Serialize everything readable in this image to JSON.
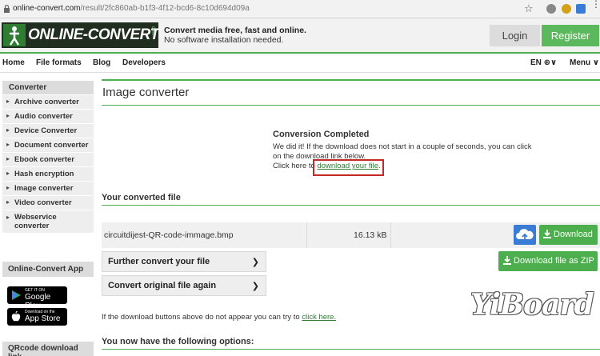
{
  "browser": {
    "url_domain": "online-convert.com",
    "url_path": "/result/2fc860ab-b1f3-4f12-bcd6-8c10d694d09a"
  },
  "header": {
    "logo_text_main": "ONLINE-",
    "logo_text_end": "CONVERT",
    "logo_com": "com",
    "tagline_1": "Convert media free, fast and online.",
    "tagline_2": "No software installation needed.",
    "login": "Login",
    "register": "Register"
  },
  "nav": {
    "items": [
      "Home",
      "File formats",
      "Blog",
      "Developers"
    ],
    "lang": "EN ⊕∨",
    "menu": "Menu ∨"
  },
  "sidebar": {
    "heading": "Converter",
    "items": [
      "Archive converter",
      "Audio converter",
      "Device Converter",
      "Document converter",
      "Ebook converter",
      "Hash encryption",
      "Image converter",
      "Video converter",
      "Webservice converter"
    ],
    "app_heading": "Online-Convert App",
    "google_play_small": "GET IT ON",
    "google_play": "Google Play",
    "app_store_small": "Download on the",
    "app_store": "App Store",
    "qr_heading": "QRcode download link"
  },
  "main": {
    "title": "Image converter",
    "conversion_heading": "Conversion Completed",
    "conversion_body": "We did it! If the download does not start in a couple of seconds, you can click on the download link below.",
    "click_here_prefix": "Click here to ",
    "download_link": "download your file",
    "period": ".",
    "converted_heading": "Your converted file",
    "file_name": "circuitdijest-QR-code-immage.bmp",
    "file_size": "16.13 kB",
    "download_button": "Download",
    "download_zip_button": "Download file as ZIP",
    "further_convert": "Further convert your file",
    "convert_again": "Convert original file again",
    "note_prefix": "If the download buttons above do not appear you can try to ",
    "note_link": "click here.",
    "options_heading": "You now have the following options:"
  },
  "watermark": "YiBoard",
  "colors": {
    "brand_green": "#4cae4c",
    "cloud_blue": "#3a7bd5",
    "highlight_red": "#c62828"
  }
}
